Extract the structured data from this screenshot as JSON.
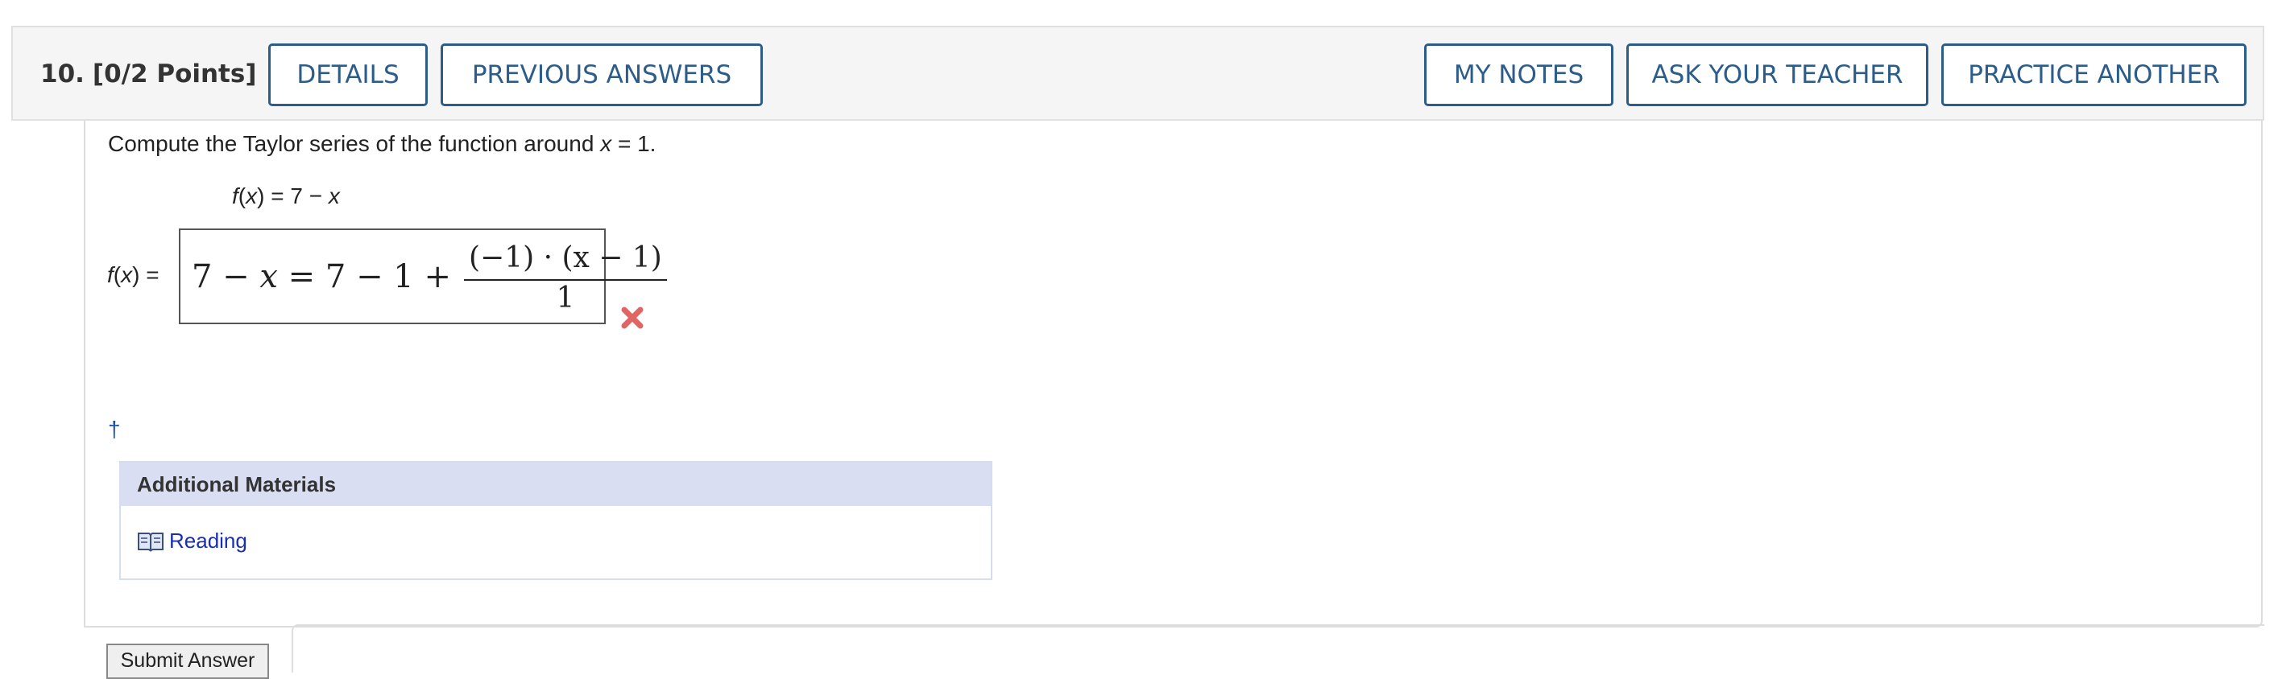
{
  "question": {
    "number": "10.",
    "points": "[0/2 Points]"
  },
  "header_buttons": {
    "details": "DETAILS",
    "previous_answers": "PREVIOUS ANSWERS",
    "my_notes": "MY NOTES",
    "ask_teacher": "ASK YOUR TEACHER",
    "practice_another": "PRACTICE ANOTHER"
  },
  "colors": {
    "accent": "#2b5c8a",
    "incorrect": "#e06666",
    "materials_header": "#d9def2",
    "link": "#1a2fb0"
  },
  "problem": {
    "prompt_before": "Compute the Taylor series of the function around ",
    "prompt_var": "x",
    "prompt_after": " = 1.",
    "given_fx_var": "f",
    "given_fx_arg": "x",
    "given_rhs_const": " = 7 − ",
    "given_rhs_var": "x"
  },
  "answer": {
    "label_f": "f",
    "label_x": "x",
    "label_eq": ") =",
    "expr_lead": "7 − ",
    "expr_var": "x",
    "expr_rest": " = 7 − 1 + ",
    "frac_numerator": "(−1) · (x − 1)",
    "frac_denominator": "1",
    "status_icon": "incorrect-x-icon"
  },
  "footnote_marker": "†",
  "additional_materials": {
    "heading": "Additional Materials",
    "items": [
      {
        "label": "Reading",
        "icon": "book-icon"
      }
    ]
  },
  "submit": {
    "label": "Submit Answer"
  }
}
